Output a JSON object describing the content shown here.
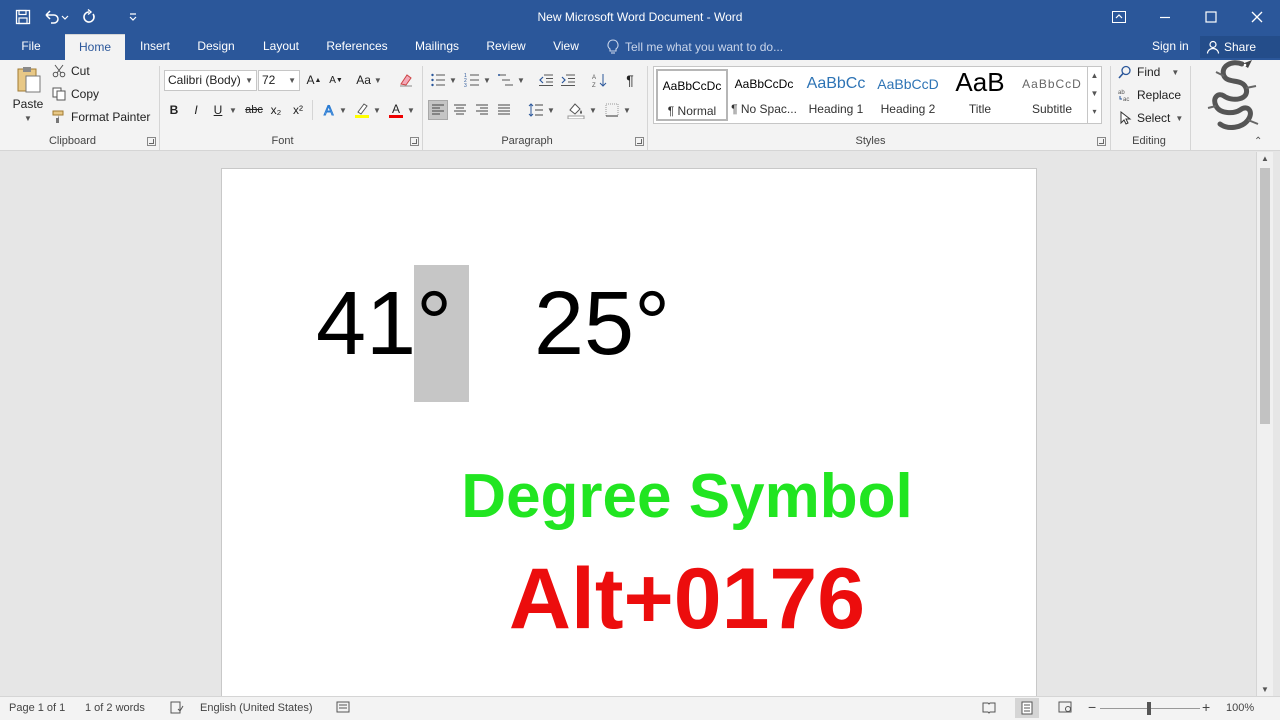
{
  "app": {
    "title": "New Microsoft Word Document - Word"
  },
  "qat": {
    "save_icon": "save-icon",
    "undo_icon": "undo-icon",
    "redo_icon": "redo-icon",
    "customize_icon": "customize-qat-icon"
  },
  "tabs": [
    {
      "label": "File"
    },
    {
      "label": "Home"
    },
    {
      "label": "Insert"
    },
    {
      "label": "Design"
    },
    {
      "label": "Layout"
    },
    {
      "label": "References"
    },
    {
      "label": "Mailings"
    },
    {
      "label": "Review"
    },
    {
      "label": "View"
    }
  ],
  "tell_me": {
    "placeholder": "Tell me what you want to do..."
  },
  "account": {
    "signin": "Sign in",
    "share": "Share"
  },
  "clipboard": {
    "paste": "Paste",
    "cut": "Cut",
    "copy": "Copy",
    "format_painter": "Format Painter",
    "group": "Clipboard"
  },
  "font": {
    "family": "Calibri (Body)",
    "size": "72",
    "change_case": "Aa",
    "bold": "B",
    "italic": "I",
    "underline": "U",
    "strike": "abc",
    "subscript": "x₂",
    "superscript": "x²",
    "font_color": "A",
    "group": "Font"
  },
  "paragraph": {
    "group": "Paragraph"
  },
  "styles": {
    "items": [
      {
        "sample": "AaBbCcDc",
        "name": "¶ Normal"
      },
      {
        "sample": "AaBbCcDc",
        "name": "¶ No Spac..."
      },
      {
        "sample": "AaBbCc",
        "name": "Heading 1"
      },
      {
        "sample": "AaBbCcD",
        "name": "Heading 2"
      },
      {
        "sample": "AaB",
        "name": "Title"
      },
      {
        "sample": "AaBbCcD",
        "name": "Subtitle"
      }
    ],
    "group": "Styles"
  },
  "editing": {
    "find": "Find",
    "replace": "Replace",
    "select": "Select",
    "group": "Editing"
  },
  "document": {
    "value_1": "41°",
    "value_2": "25°",
    "heading": "Degree Symbol",
    "shortcut": "Alt+0176"
  },
  "status": {
    "page": "Page 1 of 1",
    "words": "1 of 2 words",
    "language": "English (United States)",
    "zoom": "100%"
  },
  "colors": {
    "accent": "#2b579a",
    "heading": "#21e521",
    "shortcut": "#ec0d0d"
  }
}
